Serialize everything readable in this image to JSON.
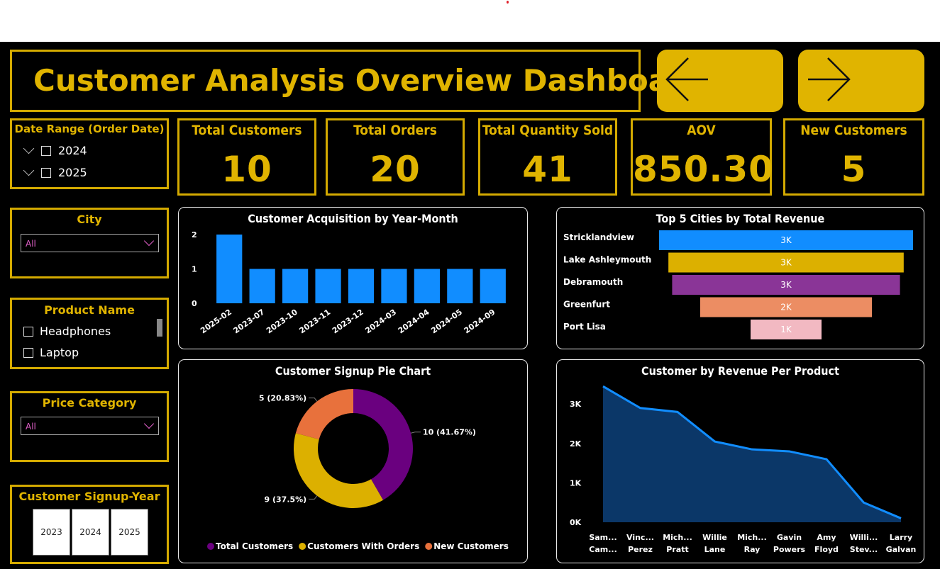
{
  "dashboard": {
    "title": "Customer Analysis Overview Dashboard",
    "back_icon": "arrow-left-icon",
    "forward_icon": "arrow-right-icon",
    "accent_color": "#e0b400"
  },
  "kpis": [
    {
      "label": "Total Customers",
      "value": "10"
    },
    {
      "label": "Total Orders",
      "value": "20"
    },
    {
      "label": "Total Quantity Sold",
      "value": "41"
    },
    {
      "label": "AOV",
      "value": "850.30"
    },
    {
      "label": "New Customers",
      "value": "5"
    }
  ],
  "slicers": {
    "date_range": {
      "title": "Date Range (Order Date)",
      "items": [
        "2024",
        "2025"
      ]
    },
    "city": {
      "title": "City",
      "selected": "All"
    },
    "product_name": {
      "title": "Product Name",
      "items": [
        "Headphones",
        "Laptop"
      ]
    },
    "price_category": {
      "title": "Price Category",
      "selected": "All"
    },
    "signup_year": {
      "title": "Customer Signup-Year",
      "items": [
        "2023",
        "2024",
        "2025"
      ]
    }
  },
  "chart_data": [
    {
      "type": "bar",
      "title": "Customer Acquisition by Year-Month",
      "categories": [
        "2025-02",
        "2023-07",
        "2023-10",
        "2023-11",
        "2023-12",
        "2024-03",
        "2024-04",
        "2024-05",
        "2024-09"
      ],
      "values": [
        2,
        1,
        1,
        1,
        1,
        1,
        1,
        1,
        1
      ],
      "yticks": [
        "0",
        "1",
        "2"
      ],
      "ylim": [
        0,
        2
      ],
      "color": "#118dff"
    },
    {
      "type": "bar",
      "title": "Top 5 Cities by Total Revenue",
      "categories": [
        "Stricklandview",
        "Lake Ashleymouth",
        "Debramouth",
        "Greenfurt",
        "Port Lisa"
      ],
      "values": [
        3400,
        3150,
        3050,
        2300,
        950
      ],
      "labels": [
        "3K",
        "3K",
        "3K",
        "2K",
        "1K"
      ],
      "colors": [
        "#118dff",
        "#dcb000",
        "#8a3597",
        "#ec8d63",
        "#f2b9c2"
      ]
    },
    {
      "type": "pie",
      "title": "Customer Signup Pie Chart",
      "slices": [
        {
          "name": "Total Customers",
          "value": 10,
          "label": "10 (41.67%)",
          "color": "#6a007f"
        },
        {
          "name": "Customers With Orders",
          "value": 9,
          "label": "9 (37.5%)",
          "color": "#dcb000"
        },
        {
          "name": "New Customers",
          "value": 5,
          "label": "5 (20.83%)",
          "color": "#e8713c"
        }
      ]
    },
    {
      "type": "area",
      "title": "Customer by Revenue Per Product",
      "categories": [
        [
          "Sam...",
          "Cam..."
        ],
        [
          "Vinc...",
          "Perez"
        ],
        [
          "Mich...",
          "Pratt"
        ],
        [
          "Willie",
          "Lane"
        ],
        [
          "Mich...",
          "Ray"
        ],
        [
          "Gavin",
          "Powers"
        ],
        [
          "Amy",
          "Floyd"
        ],
        [
          "Willi...",
          "Stev..."
        ],
        [
          "Larry",
          "Galvan"
        ]
      ],
      "values": [
        3450,
        2900,
        2800,
        2050,
        1850,
        1800,
        1600,
        500,
        100
      ],
      "yticks": [
        "0K",
        "1K",
        "2K",
        "3K"
      ],
      "ylim": [
        0,
        3400
      ],
      "color": "#118dff"
    }
  ]
}
